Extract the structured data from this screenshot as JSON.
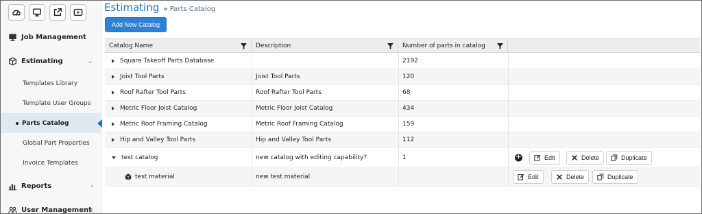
{
  "top_icons": [
    "dashboard-icon",
    "monitor-icon",
    "external-link-icon",
    "play-icon"
  ],
  "nav": {
    "job_management": "Job Management",
    "estimating": "Estimating",
    "estimating_sub": [
      "Templates Library",
      "Template User Groups",
      "Parts Catalog",
      "Global Part Properties",
      "Invoice Templates"
    ],
    "reports": "Reports",
    "user_management": "User Management"
  },
  "page": {
    "title": "Estimating",
    "breadcrumb_sep": "»",
    "breadcrumb": "Parts Catalog",
    "add_button": "Add New Catalog"
  },
  "table": {
    "headers": [
      "Catalog Name",
      "Description",
      "Number of parts in catalog"
    ],
    "rows": [
      {
        "name": "Square Takeoff Parts Database",
        "description": "",
        "count": "2192"
      },
      {
        "name": "Joist Tool Parts",
        "description": "Joist Tool Parts",
        "count": "120"
      },
      {
        "name": "Roof Rafter Tool Parts",
        "description": "Roof Rafter Tool Parts",
        "count": "68"
      },
      {
        "name": "Metric Floor Joist Catalog",
        "description": "Metric Floor Joist Catalog",
        "count": "434"
      },
      {
        "name": "Metric Roof Framing Catalog",
        "description": "Metric Roof Framing Catalog",
        "count": "159"
      },
      {
        "name": "Hip and Valley Tool Parts",
        "description": "Hip and Valley Tool Parts",
        "count": "112"
      },
      {
        "name": "test catalog",
        "description": "new catalog with editing capability?",
        "count": "1"
      }
    ],
    "child_row": {
      "name": "test material",
      "description": "new test material"
    },
    "actions": {
      "edit": "Edit",
      "delete": "Delete",
      "duplicate": "Duplicate"
    }
  },
  "colors": {
    "accent": "#1f6fb8",
    "button": "#2f81d6",
    "active_bg": "#dfe9f3"
  }
}
